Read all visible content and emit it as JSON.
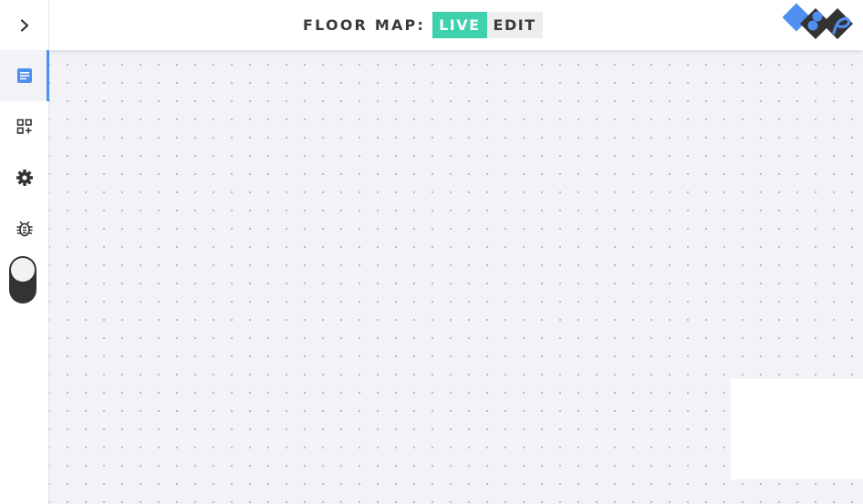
{
  "header": {
    "title_label": "FLOOR MAP:",
    "live_label": "LIVE",
    "edit_label": "EDIT",
    "active_mode": "LIVE"
  },
  "sidebar": {
    "items": [
      {
        "icon": "chevron-right-icon",
        "active": false
      },
      {
        "icon": "document-icon",
        "active": true
      },
      {
        "icon": "add-widget-icon",
        "active": false
      },
      {
        "icon": "gear-icon",
        "active": false
      },
      {
        "icon": "bug-icon",
        "active": false
      }
    ],
    "theme_toggle": {
      "icon": "theme-toggle",
      "state": "off"
    }
  },
  "logo": {
    "icon": "brand-logo-icon"
  },
  "colors": {
    "accent_live": "#3fd0ad",
    "active_indicator": "#4f8ff0",
    "logo_blue": "#4f8ff0",
    "logo_dark": "#333333"
  }
}
